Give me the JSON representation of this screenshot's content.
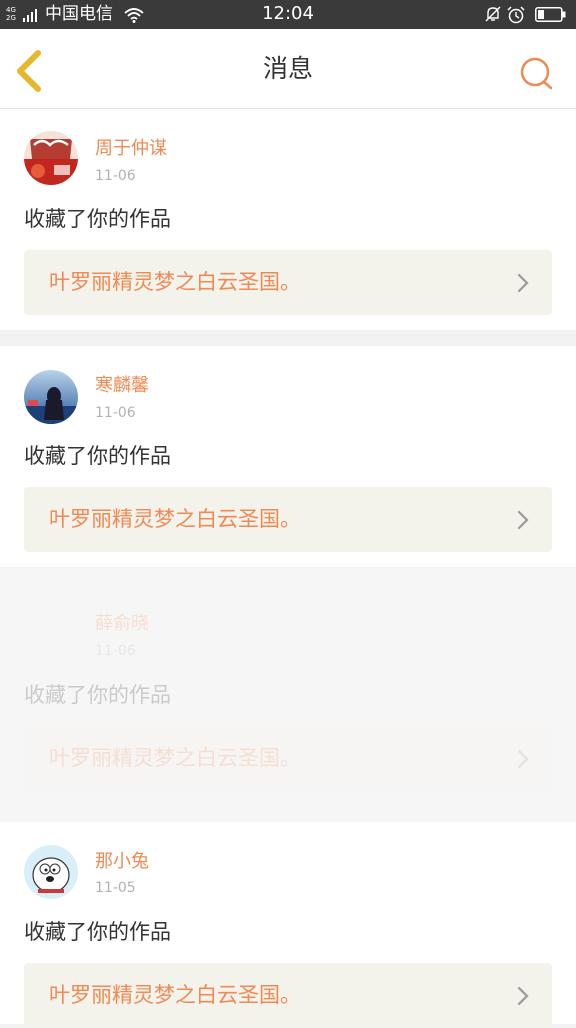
{
  "status_bar": {
    "network_badge_top": "4G",
    "network_badge_bottom": "2G",
    "carrier": "中国电信",
    "time": "12:04",
    "icons": [
      "signal-icon",
      "wifi-icon",
      "bell-muted-icon",
      "alarm-icon",
      "battery-icon"
    ]
  },
  "header": {
    "title": "消息",
    "back_icon": "back-chevron-icon",
    "search_icon": "search-icon"
  },
  "messages": [
    {
      "user": "周于仲谋",
      "date": "11-06",
      "action": "收藏了你的作品",
      "work_title": "叶罗丽精灵梦之白云圣国。"
    },
    {
      "user": "寒麟馨",
      "date": "11-06",
      "action": "收藏了你的作品",
      "work_title": "叶罗丽精灵梦之白云圣国。"
    },
    {
      "user": "薛俞晓",
      "date": "11-06",
      "action": "收藏了你的作品",
      "work_title": "叶罗丽精灵梦之白云圣国。"
    },
    {
      "user": "那小兔",
      "date": "11-05",
      "action": "收藏了你的作品",
      "work_title": "叶罗丽精灵梦之白云圣国。"
    }
  ],
  "colors": {
    "accent": "#ef8a54",
    "back_icon": "#e8b82c",
    "status_bar_bg": "#3a3a3a",
    "work_card_bg": "#f3f2eb"
  }
}
